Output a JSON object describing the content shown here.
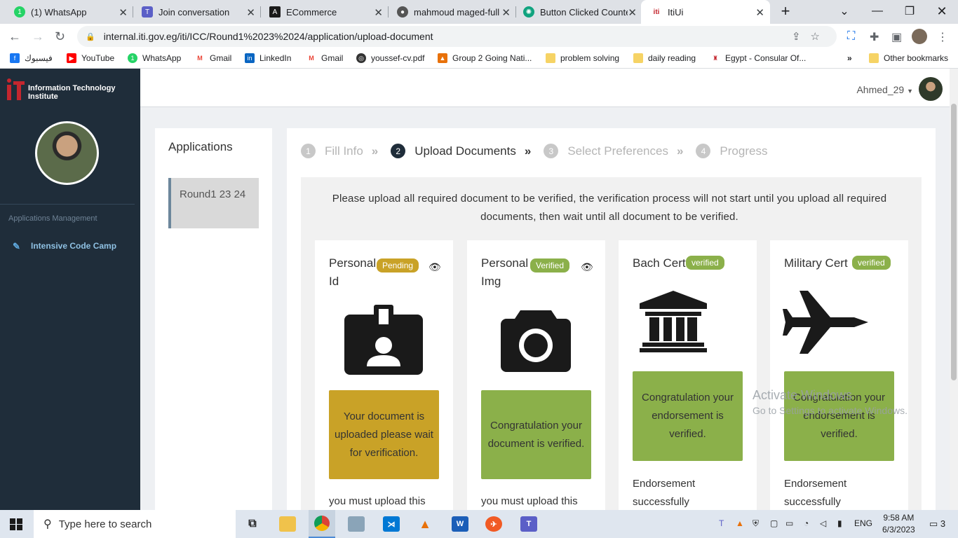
{
  "browser": {
    "tabs": [
      {
        "title": "(1) WhatsApp",
        "icon": "whatsapp-icon",
        "color": "#25d366"
      },
      {
        "title": "Join conversation",
        "icon": "teams-icon",
        "color": "#5b5fc7"
      },
      {
        "title": "ECommerce",
        "icon": "angular-icon",
        "color": "#1a1a1a"
      },
      {
        "title": "mahmoud maged-full",
        "icon": "github-icon",
        "color": "#555555"
      },
      {
        "title": "Button Clicked Counte",
        "icon": "chatgpt-icon",
        "color": "#10a37f"
      },
      {
        "title": "ItiUi",
        "icon": "iti-icon",
        "color": "#c4262e"
      }
    ],
    "url": "internal.iti.gov.eg/iti/ICC/Round1%2023%2024/application/upload-document",
    "bookmarks": [
      {
        "label": "فيسبوك",
        "icon": "facebook-icon",
        "color": "#1877f2"
      },
      {
        "label": "YouTube",
        "icon": "youtube-icon",
        "color": "#ff0000"
      },
      {
        "label": "WhatsApp",
        "icon": "whatsapp-icon",
        "color": "#25d366"
      },
      {
        "label": "Gmail",
        "icon": "gmail-icon",
        "color": "#ea4335"
      },
      {
        "label": "LinkedIn",
        "icon": "linkedin-icon",
        "color": "#0a66c2"
      },
      {
        "label": "Gmail",
        "icon": "gmail-icon",
        "color": "#ea4335"
      },
      {
        "label": "youssef-cv.pdf",
        "icon": "globe-icon",
        "color": "#333333"
      },
      {
        "label": "Group 2 Going Nati...",
        "icon": "badge-icon",
        "color": "#e8710a"
      },
      {
        "label": "problem solving",
        "icon": "folder-icon",
        "color": "#f6d365"
      },
      {
        "label": "daily reading",
        "icon": "folder-icon",
        "color": "#f6d365"
      },
      {
        "label": "Egypt - Consular Of...",
        "icon": "egypt-icon",
        "color": "#c4262e"
      }
    ],
    "other_bookmarks": "Other bookmarks"
  },
  "sidebar": {
    "brand": "Information Technology Institute",
    "section": "Applications Management",
    "item": "Intensive Code Camp"
  },
  "topbar": {
    "username": "Ahmed_29"
  },
  "applications": {
    "heading": "Applications",
    "round": "Round1 23 24"
  },
  "steps": [
    {
      "num": "1",
      "label": "Fill Info"
    },
    {
      "num": "2",
      "label": "Upload Documents"
    },
    {
      "num": "3",
      "label": "Select Preferences"
    },
    {
      "num": "4",
      "label": "Progress"
    }
  ],
  "notice": "Please upload all required document to be verified, the verification process will not start until you upload all required documents, then wait until all document to be verified.",
  "cards": [
    {
      "title": "Personal Id",
      "badge": "Pending",
      "message": "Your document is uploaded please wait for verification.",
      "tail": "you must upload this"
    },
    {
      "title": "Personal Img",
      "badge": "Verified",
      "message": "Congratulation your document is verified.",
      "tail": "you must upload this"
    },
    {
      "title": "Bach Cert",
      "badge": "verified",
      "message": "Congratulation your endorsement is verified.",
      "tail": "Endorsement successfully"
    },
    {
      "title": "Military Cert",
      "badge": "verified",
      "message": "Congratulation your endorsement is verified.",
      "tail": "Endorsement successfully"
    }
  ],
  "colors": {
    "pending": "#c9a227",
    "verified": "#8bb04a",
    "sidebar": "#1f2d3a"
  },
  "watermark": {
    "line1": "Activate Windows",
    "line2": "Go to Settings to activate Windows."
  },
  "taskbar": {
    "search_placeholder": "Type here to search",
    "lang": "ENG",
    "time": "9:58 AM",
    "date": "6/3/2023",
    "notifications": "3"
  }
}
